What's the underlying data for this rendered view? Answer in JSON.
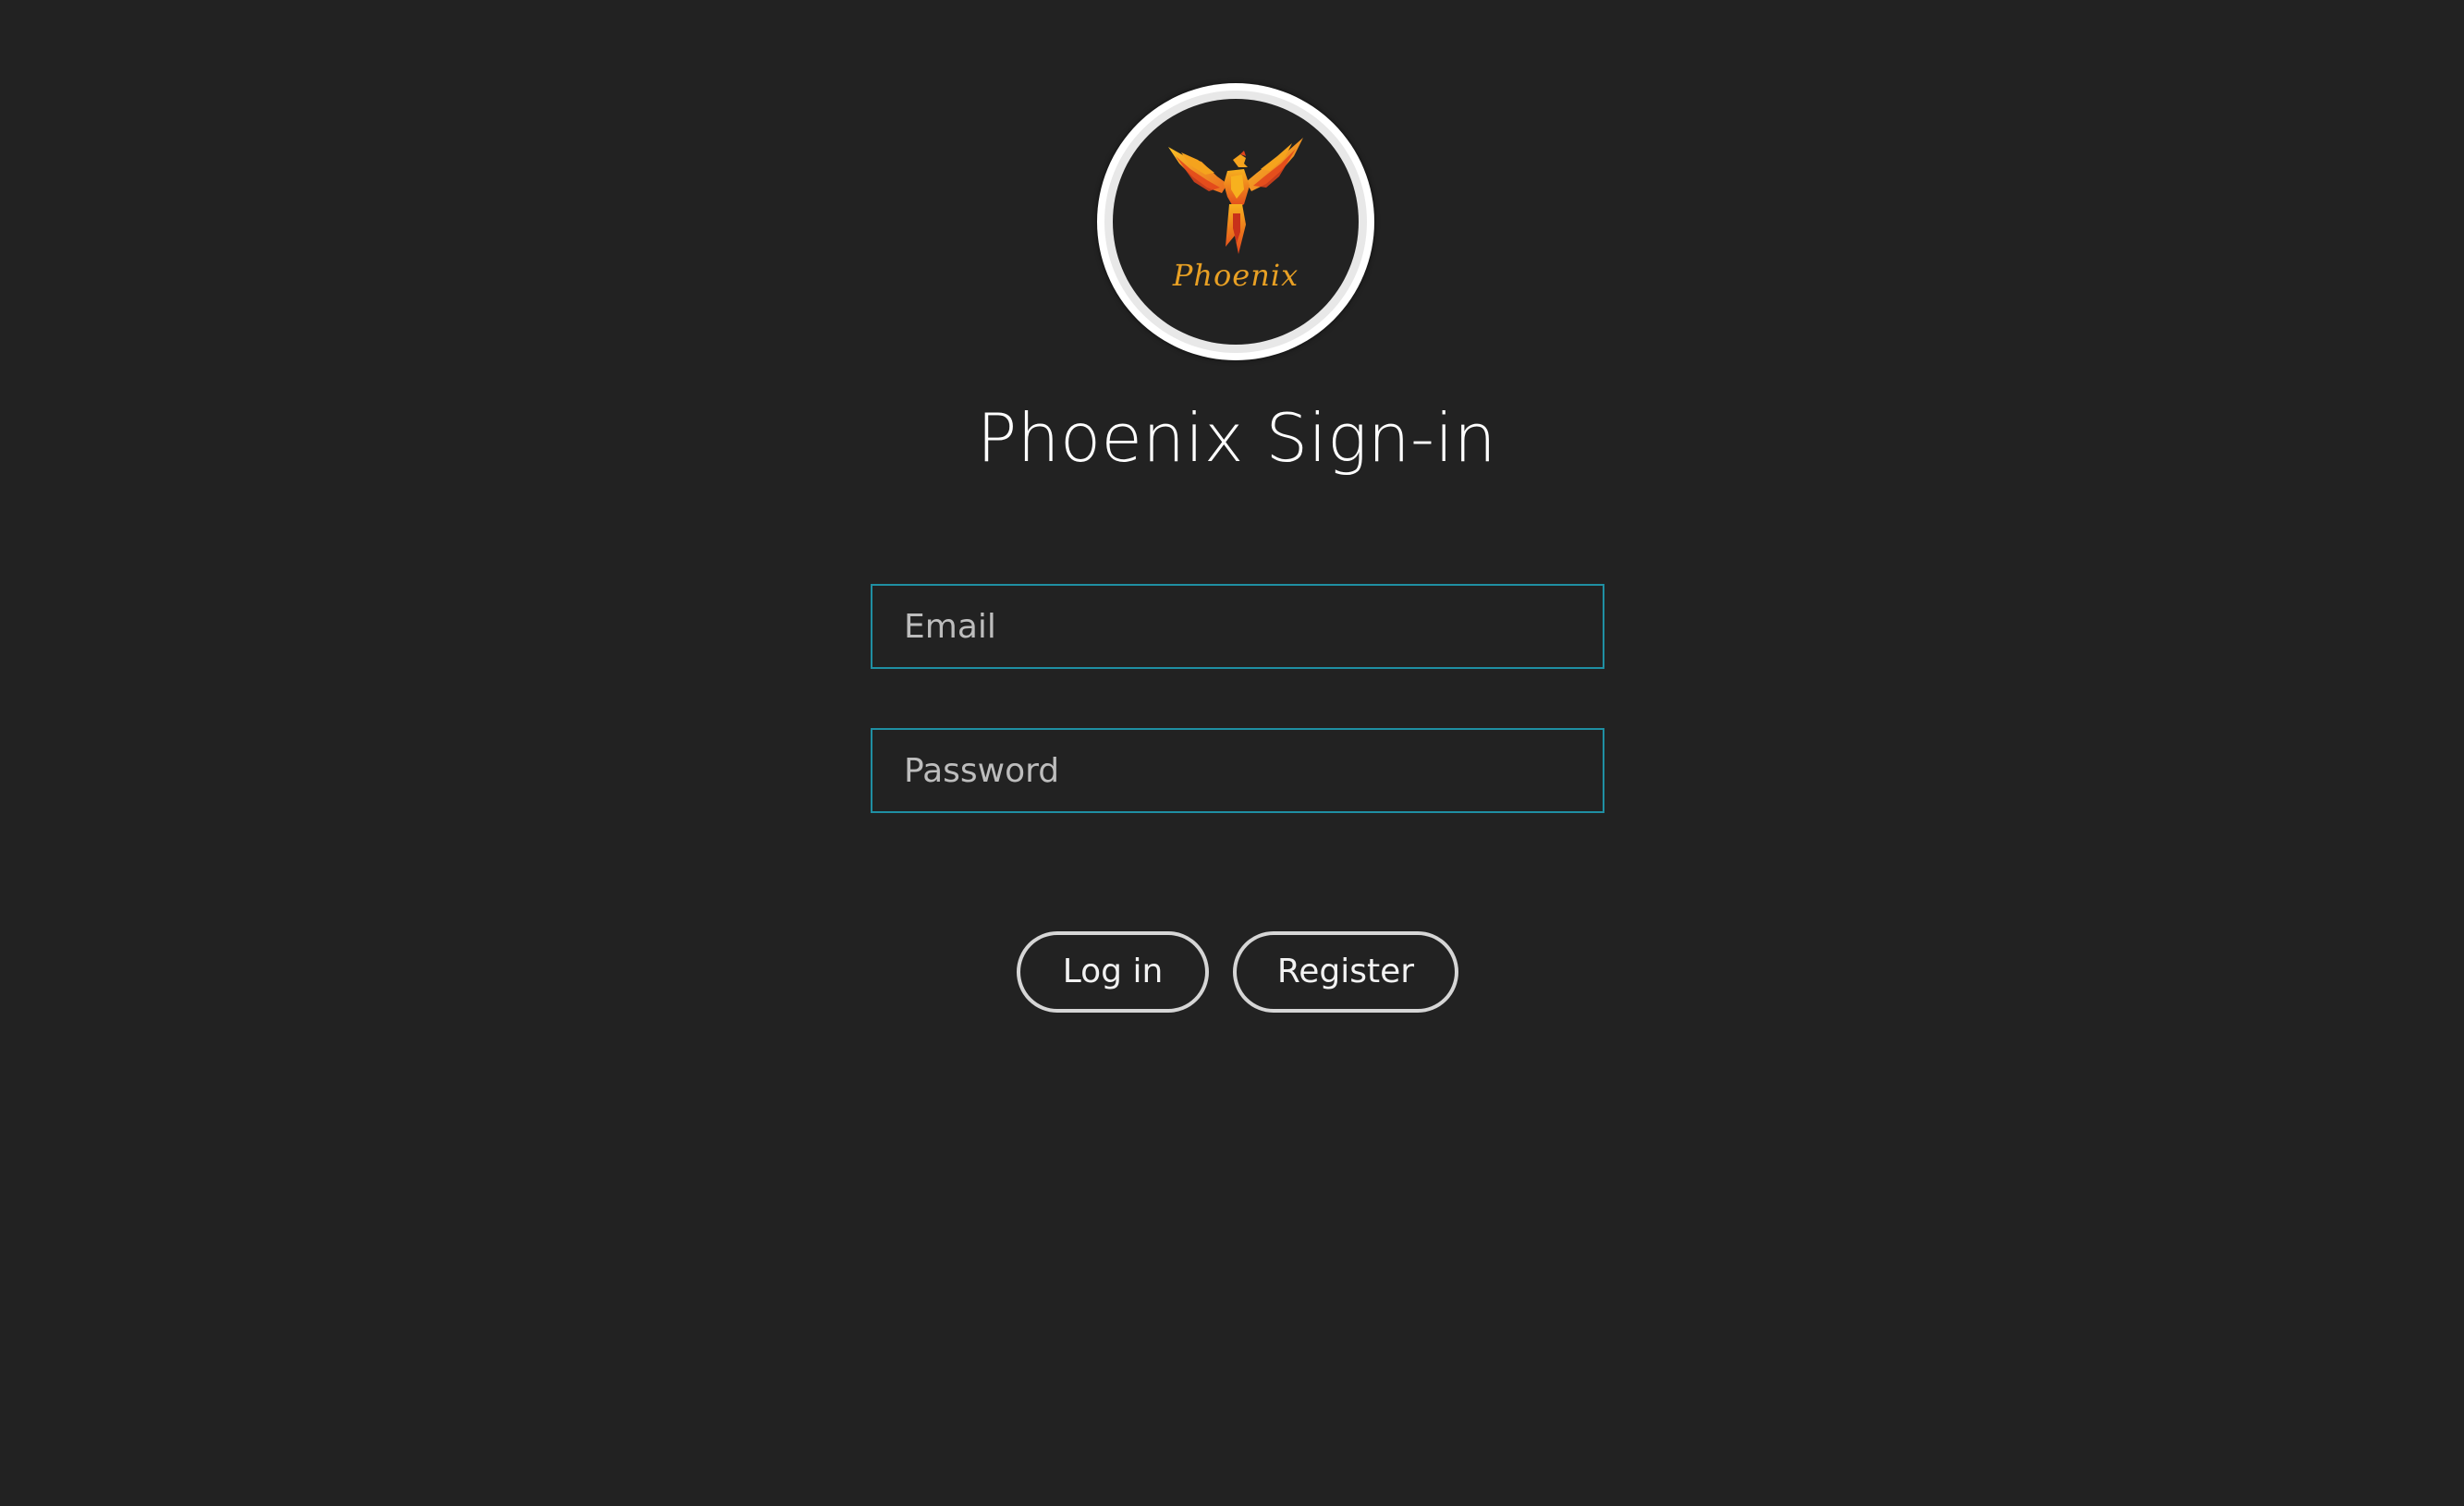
{
  "logo": {
    "text": "Phoenix",
    "colors": {
      "primary": "#e8a024",
      "flame": "#e2431b",
      "ring": "#ffffff"
    }
  },
  "page": {
    "title": "Phoenix Sign-in",
    "background": "#222222",
    "accent": "#1f8fa3"
  },
  "form": {
    "email_placeholder": "Email",
    "password_placeholder": "Password"
  },
  "actions": {
    "login_label": "Log in",
    "register_label": "Register"
  }
}
